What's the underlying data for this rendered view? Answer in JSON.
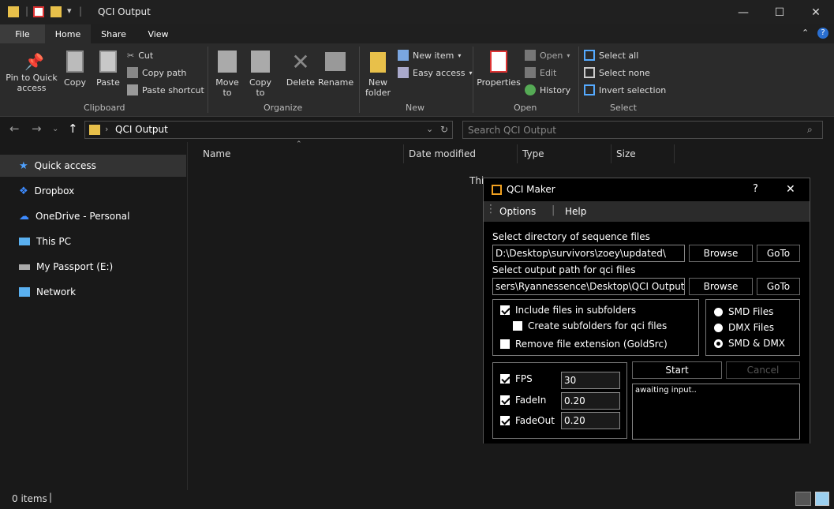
{
  "window": {
    "title": "QCI Output"
  },
  "titlebar_controls": {
    "minimize": "—",
    "maximize": "☐",
    "close": "✕"
  },
  "ribbon_tabs": [
    "File",
    "Home",
    "Share",
    "View"
  ],
  "ribbon": {
    "clipboard": {
      "pin": "Pin to Quick access",
      "copy": "Copy",
      "paste": "Paste",
      "cut": "Cut",
      "copy_path": "Copy path",
      "paste_shortcut": "Paste shortcut",
      "group": "Clipboard"
    },
    "organize": {
      "move_to": "Move to",
      "copy_to": "Copy to",
      "delete": "Delete",
      "rename": "Rename",
      "group": "Organize"
    },
    "new": {
      "new_folder": "New folder",
      "new_item": "New item",
      "easy_access": "Easy access",
      "group": "New"
    },
    "open": {
      "properties": "Properties",
      "open": "Open",
      "edit": "Edit",
      "history": "History",
      "group": "Open"
    },
    "select": {
      "select_all": "Select all",
      "select_none": "Select none",
      "invert": "Invert selection",
      "group": "Select"
    }
  },
  "address": {
    "path": "QCI Output",
    "search_placeholder": "Search QCI Output"
  },
  "nav_pane": [
    {
      "label": "Quick access",
      "icon": "star-icon"
    },
    {
      "label": "Dropbox",
      "icon": "dropbox-icon"
    },
    {
      "label": "OneDrive - Personal",
      "icon": "cloud-icon"
    },
    {
      "label": "This PC",
      "icon": "pc-icon"
    },
    {
      "label": "My Passport (E:)",
      "icon": "drive-icon"
    },
    {
      "label": "Network",
      "icon": "network-icon"
    }
  ],
  "columns": [
    "Name",
    "Date modified",
    "Type",
    "Size"
  ],
  "empty_text": "This",
  "status": {
    "items": "0 items"
  },
  "dialog": {
    "title": "QCI Maker",
    "help": "?",
    "close": "✕",
    "menu": [
      "Options",
      "Help"
    ],
    "seq_label": "Select directory of sequence files",
    "seq_path": "D:\\Desktop\\survivors\\zoey\\updated\\",
    "out_label": "Select output path for qci files",
    "out_path": "sers\\Ryannessence\\Desktop\\QCI Output\\",
    "browse": "Browse",
    "goto": "GoTo",
    "include_sub": "Include files in subfolders",
    "create_sub": "Create subfolders for qci files",
    "remove_ext": "Remove file extension (GoldSrc)",
    "radio": [
      "SMD Files",
      "DMX Files",
      "SMD & DMX"
    ],
    "fps_label": "FPS",
    "fps": "30",
    "fadein_label": "FadeIn",
    "fadein": "0.20",
    "fadeout_label": "FadeOut",
    "fadeout": "0.20",
    "start": "Start",
    "cancel": "Cancel",
    "log": "awaiting input.."
  }
}
